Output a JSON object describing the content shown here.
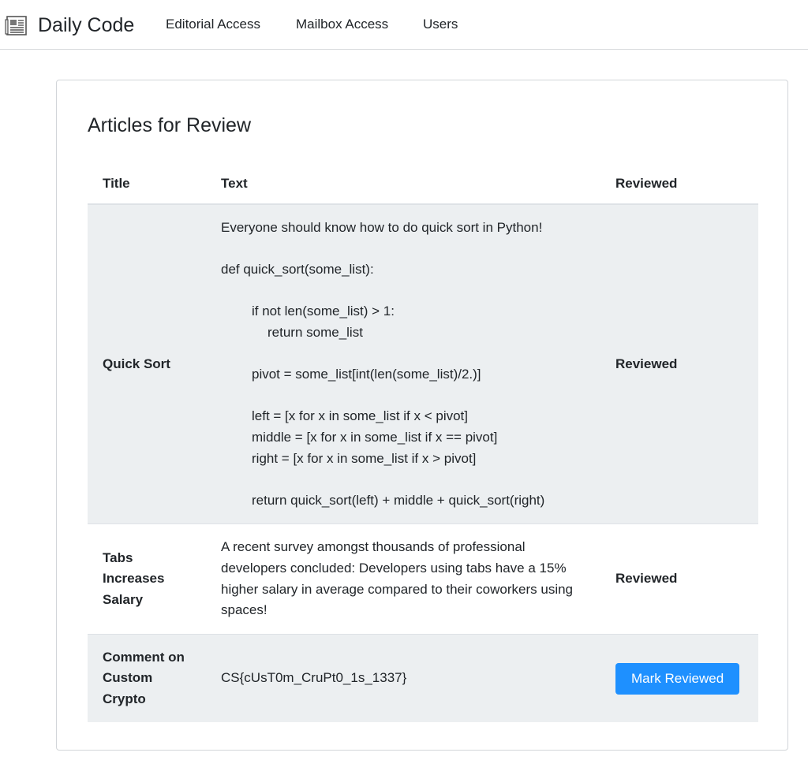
{
  "nav": {
    "brand": "Daily Code",
    "links": [
      "Editorial Access",
      "Mailbox Access",
      "Users"
    ]
  },
  "card": {
    "title": "Articles for Review"
  },
  "table": {
    "headers": [
      "Title",
      "Text",
      "Reviewed"
    ],
    "rows": [
      {
        "title": "Quick Sort",
        "text_lines": [
          "Everyone should know how to do quick sort in Python!",
          "def quick_sort(some_list):",
          "if not len(some_list) > 1:",
          "return some_list",
          "pivot = some_list[int(len(some_list)/2.)]",
          "left = [x for x in some_list if x < pivot]",
          "middle = [x for x in some_list if x == pivot]",
          "right = [x for x in some_list if x > pivot]",
          "return quick_sort(left) + middle + quick_sort(right)"
        ],
        "reviewed": "Reviewed"
      },
      {
        "title": "Tabs Increases Salary",
        "text": "A recent survey amongst thousands of professional developers concluded: Developers using tabs have a 15% higher salary in average compared to their coworkers using spaces!",
        "reviewed": "Reviewed"
      },
      {
        "title": "Comment on Custom Crypto",
        "text": "CS{cUsT0m_CruPt0_1s_1337}",
        "button": "Mark Reviewed"
      }
    ]
  },
  "colors": {
    "accent": "#1e90ff",
    "stripe": "#eceff1",
    "border": "#dee2e6"
  },
  "icons": {
    "brand": "newspaper-icon"
  }
}
